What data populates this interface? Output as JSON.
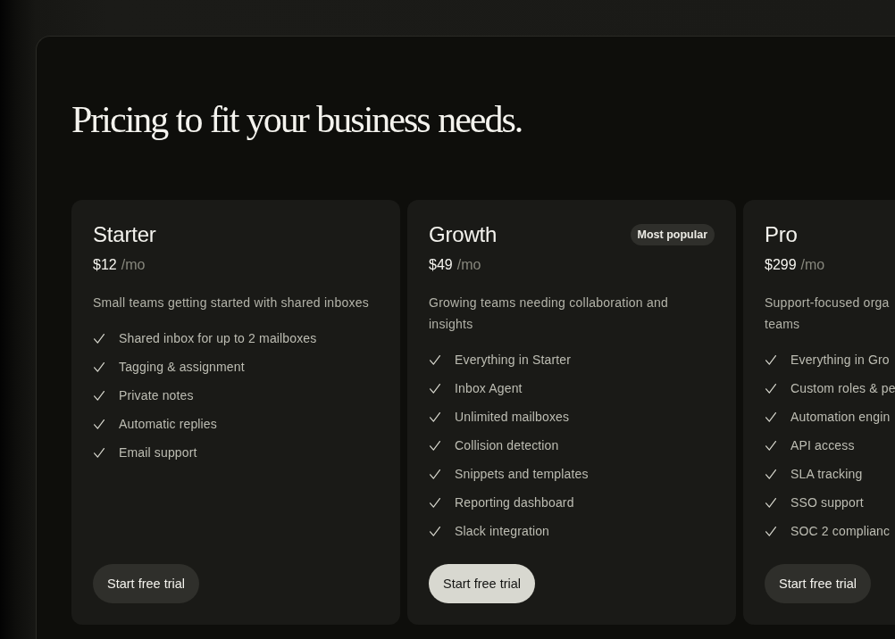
{
  "heading": "Pricing to fit your business needs.",
  "plans": [
    {
      "name": "Starter",
      "price": "$12",
      "period": "/mo",
      "description": "Small teams getting started with shared inboxes",
      "features": [
        "Shared inbox for up to 2 mailboxes",
        "Tagging & assignment",
        "Private notes",
        "Automatic replies",
        "Email support"
      ],
      "button": {
        "label": "Start free trial",
        "primary": false
      }
    },
    {
      "name": "Growth",
      "badge": "Most popular",
      "price": "$49",
      "period": "/mo",
      "description": "Growing teams needing collaboration and insights",
      "features": [
        "Everything in Starter",
        "Inbox Agent",
        "Unlimited mailboxes",
        "Collision detection",
        "Snippets and templates",
        "Reporting dashboard",
        "Slack integration"
      ],
      "button": {
        "label": "Start free trial",
        "primary": true
      }
    },
    {
      "name": "Pro",
      "price": "$299",
      "period": "/mo",
      "description": "Support-focused orga\nteams",
      "features": [
        "Everything in Gro",
        "Custom roles & pe",
        "Automation engin",
        "API access",
        "SLA tracking",
        "SSO support",
        "SOC 2 complianc"
      ],
      "button": {
        "label": "Start free trial",
        "primary": false
      }
    }
  ]
}
